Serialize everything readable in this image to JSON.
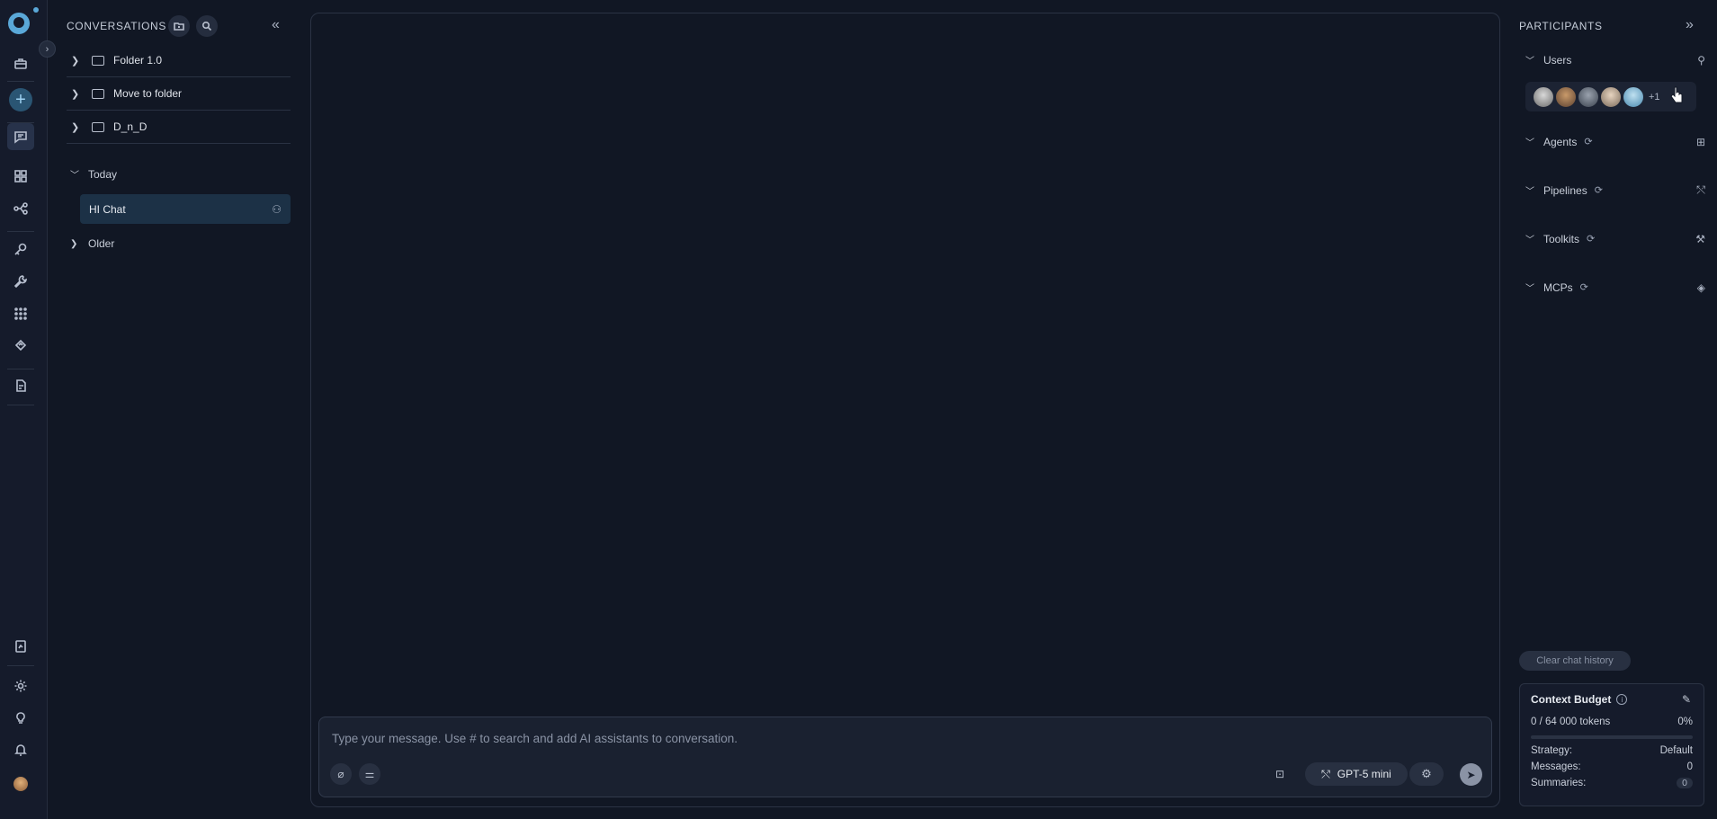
{
  "sidebar": {
    "title": "CONVERSATIONS",
    "folders": [
      {
        "name": "Folder 1.0"
      },
      {
        "name": "Move to folder"
      },
      {
        "name": "D_n_D"
      }
    ],
    "groups": {
      "today": {
        "label": "Today",
        "items": [
          {
            "label": "HI Chat"
          }
        ]
      },
      "older": {
        "label": "Older"
      }
    }
  },
  "composer": {
    "placeholder": "Type your message. Use # to search and add AI assistants to conversation.",
    "model_label": "GPT-5 mini"
  },
  "participants": {
    "title": "PARTICIPANTS",
    "users": {
      "label": "Users",
      "more_count": "+1"
    },
    "sections": [
      {
        "label": "Agents"
      },
      {
        "label": "Pipelines"
      },
      {
        "label": "Toolkits"
      },
      {
        "label": "MCPs"
      }
    ],
    "clear_history_label": "Clear chat history",
    "context_budget": {
      "title": "Context Budget",
      "tokens_text": "0 / 64 000 tokens",
      "percent_text": "0%",
      "progress_fraction": 0,
      "strategy_label": "Strategy:",
      "strategy_value": "Default",
      "messages_label": "Messages:",
      "messages_value": "0",
      "summaries_label": "Summaries:",
      "summaries_value": "0"
    }
  },
  "colors": {
    "background": "#111724",
    "rail": "#151b2b",
    "accent": "#5aa8d8",
    "selected_chat": "#1c3146"
  }
}
